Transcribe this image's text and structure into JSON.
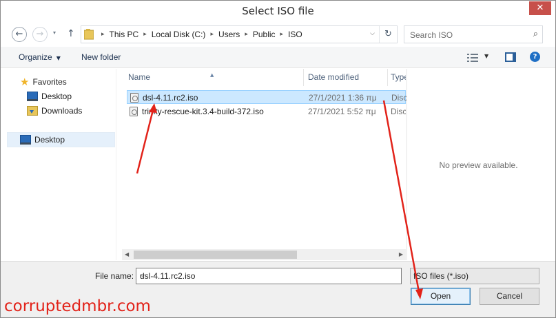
{
  "window": {
    "title": "Select ISO file",
    "close_glyph": "✕"
  },
  "address": {
    "back_glyph": "←",
    "forward_glyph": "→",
    "recent_glyph": "▾",
    "up_glyph": "↑",
    "crumbs": [
      "This PC",
      "Local Disk (C:)",
      "Users",
      "Public",
      "ISO"
    ],
    "crumb_separator": "▸",
    "dropdown_glyph": "⌵",
    "refresh_glyph": "↻"
  },
  "search": {
    "placeholder": "Search ISO",
    "icon_glyph": "⌕"
  },
  "toolbar": {
    "organize_label": "Organize",
    "organize_caret": "▼",
    "new_folder_label": "New folder",
    "view_dd_glyph": "▼",
    "help_glyph": "?"
  },
  "nav": {
    "favorites_label": "Favorites",
    "favorites_glyph": "★",
    "desktop_label": "Desktop",
    "downloads_label": "Downloads",
    "desktop_root_label": "Desktop"
  },
  "columns": {
    "name": "Name",
    "date_modified": "Date modified",
    "type": "Type",
    "sort_glyph": "▲"
  },
  "files": [
    {
      "name": "dsl-4.11.rc2.iso",
      "date": "27/1/2021 1:36 πμ",
      "type": "Disc",
      "selected": true
    },
    {
      "name": "trinity-rescue-kit.3.4-build-372.iso",
      "date": "27/1/2021 5:52 πμ",
      "type": "Disc",
      "selected": false
    }
  ],
  "scroll": {
    "left_glyph": "◀",
    "right_glyph": "▶"
  },
  "preview": {
    "empty_text": "No preview available."
  },
  "bottom": {
    "file_name_label": "File name:",
    "file_name_value": "dsl-4.11.rc2.iso",
    "file_type_value": "ISO files (*.iso)",
    "dropdown_glyph": "⌵",
    "open_label": "Open",
    "cancel_label": "Cancel"
  },
  "watermark": "corruptedmbr.com",
  "colors": {
    "close_button": "#c7504a",
    "selection": "#cce8ff",
    "annotation_arrow": "#e2231a"
  }
}
